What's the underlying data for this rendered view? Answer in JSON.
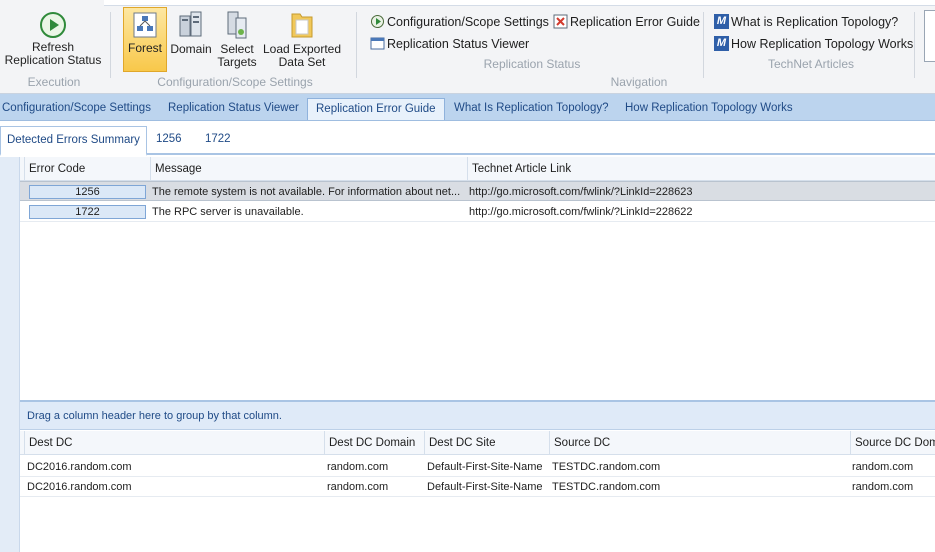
{
  "ribbon": {
    "execution": {
      "refresh_label": "Refresh Replication Status",
      "group_label": "Execution"
    },
    "scope": {
      "forest_label": "Forest",
      "domain_label": "Domain",
      "select_targets_label": "Select Targets",
      "load_label": "Load Exported Data Set",
      "group_label": "Configuration/Scope Settings"
    },
    "navigation": {
      "config_label": "Configuration/Scope Settings",
      "error_guide_label": "Replication Error Guide",
      "status_viewer_label": "Replication Status Viewer",
      "replication_status_label": "Replication Status",
      "group_label": "Navigation"
    },
    "technet": {
      "what_is_label": "What is Replication Topology?",
      "how_works_label": "How Replication Topology Works",
      "group_label": "TechNet Articles"
    }
  },
  "tabs": [
    "Configuration/Scope Settings",
    "Replication Status Viewer",
    "Replication Error Guide",
    "What Is Replication Topology?",
    "How Replication Topology Works"
  ],
  "subtabs": [
    "Detected Errors Summary",
    "1256",
    "1722"
  ],
  "errors_grid": {
    "headers": {
      "code": "Error Code",
      "message": "Message",
      "link": "Technet Article Link"
    },
    "rows": [
      {
        "code": "1256",
        "message": "The remote system is not available. For information about net...",
        "link": "http://go.microsoft.com/fwlink/?LinkId=228623"
      },
      {
        "code": "1722",
        "message": "The RPC server is unavailable.",
        "link": "http://go.microsoft.com/fwlink/?LinkId=228622"
      }
    ]
  },
  "group_hint": "Drag a column header here to group by that column.",
  "dc_grid": {
    "headers": {
      "dest_dc": "Dest DC",
      "dest_domain": "Dest DC Domain",
      "dest_site": "Dest DC Site",
      "source_dc": "Source DC",
      "source_domain": "Source DC Doma"
    },
    "rows": [
      {
        "dest_dc": "DC2016.random.com",
        "dest_domain": "random.com",
        "dest_site": "Default-First-Site-Name",
        "source_dc": "TESTDC.random.com",
        "source_domain": "random.com"
      },
      {
        "dest_dc": "DC2016.random.com",
        "dest_domain": "random.com",
        "dest_site": "Default-First-Site-Name",
        "source_dc": "TESTDC.random.com",
        "source_domain": "random.com"
      }
    ]
  },
  "colors": {
    "accent": "#1f4a86",
    "tabbar": "#bcd4ee",
    "selected_button": "#f8c84a"
  }
}
